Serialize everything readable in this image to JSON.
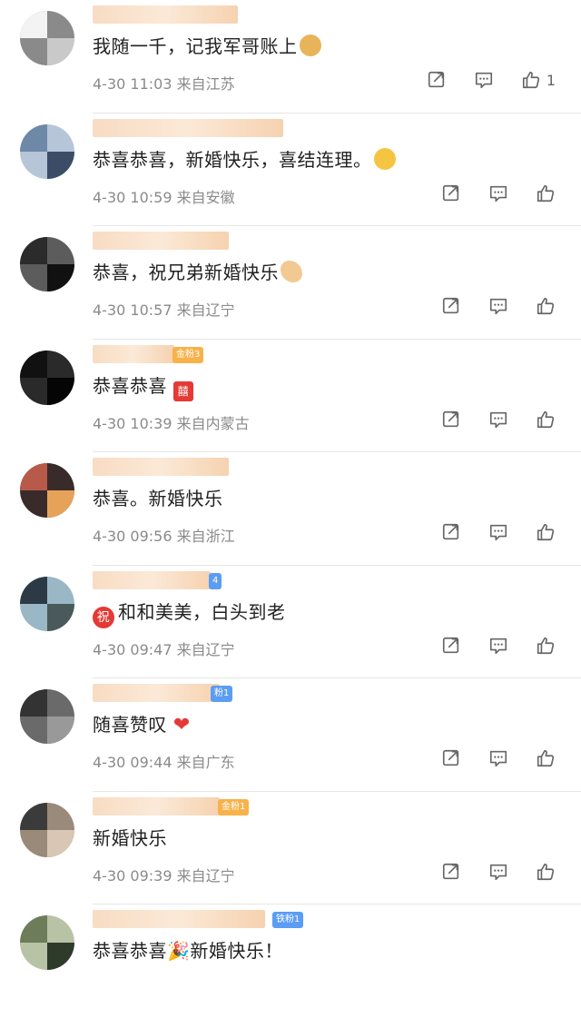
{
  "comments": [
    {
      "text": "我随一千，记我军哥账上",
      "time": "4-30 11:03",
      "location": "来自江苏",
      "likes": "1",
      "emoji": "doge"
    },
    {
      "text": "恭喜恭喜，新婚快乐，喜结连理。",
      "time": "4-30 10:59",
      "location": "来自安徽",
      "likes": "",
      "emoji": "kiss"
    },
    {
      "text": "恭喜，祝兄弟新婚快乐",
      "time": "4-30 10:57",
      "location": "来自辽宁",
      "likes": "",
      "emoji": "clap"
    },
    {
      "text": "恭喜恭喜",
      "time": "4-30 10:39",
      "location": "来自内蒙古",
      "likes": "",
      "emoji": "double-happiness",
      "badge": "金粉3"
    },
    {
      "text": "恭喜。新婚快乐",
      "time": "4-30 09:56",
      "location": "来自浙江",
      "likes": "",
      "emoji": ""
    },
    {
      "text": "和和美美，白头到老",
      "time": "4-30 09:47",
      "location": "来自辽宁",
      "likes": "",
      "emoji": "zhu",
      "badge": "4"
    },
    {
      "text": "随喜赞叹",
      "time": "4-30 09:44",
      "location": "来自广东",
      "likes": "",
      "emoji": "heart",
      "badge": "粉1"
    },
    {
      "text": "新婚快乐",
      "time": "4-30 09:39",
      "location": "来自辽宁",
      "likes": "",
      "emoji": "",
      "badge": "金粉1"
    },
    {
      "text_a": "恭喜恭喜",
      "text_b": "新婚快乐！",
      "time": "",
      "location": "",
      "likes": "",
      "emoji": "party",
      "badge": "铁粉1"
    }
  ],
  "icons": {
    "share": "share-icon",
    "comment": "comment-icon",
    "like": "like-icon"
  },
  "colors": {
    "badge_orange": "#f7b24a",
    "badge_blue": "#5b9cf4",
    "time": "#8a8a8a",
    "heart": "#e53935"
  }
}
